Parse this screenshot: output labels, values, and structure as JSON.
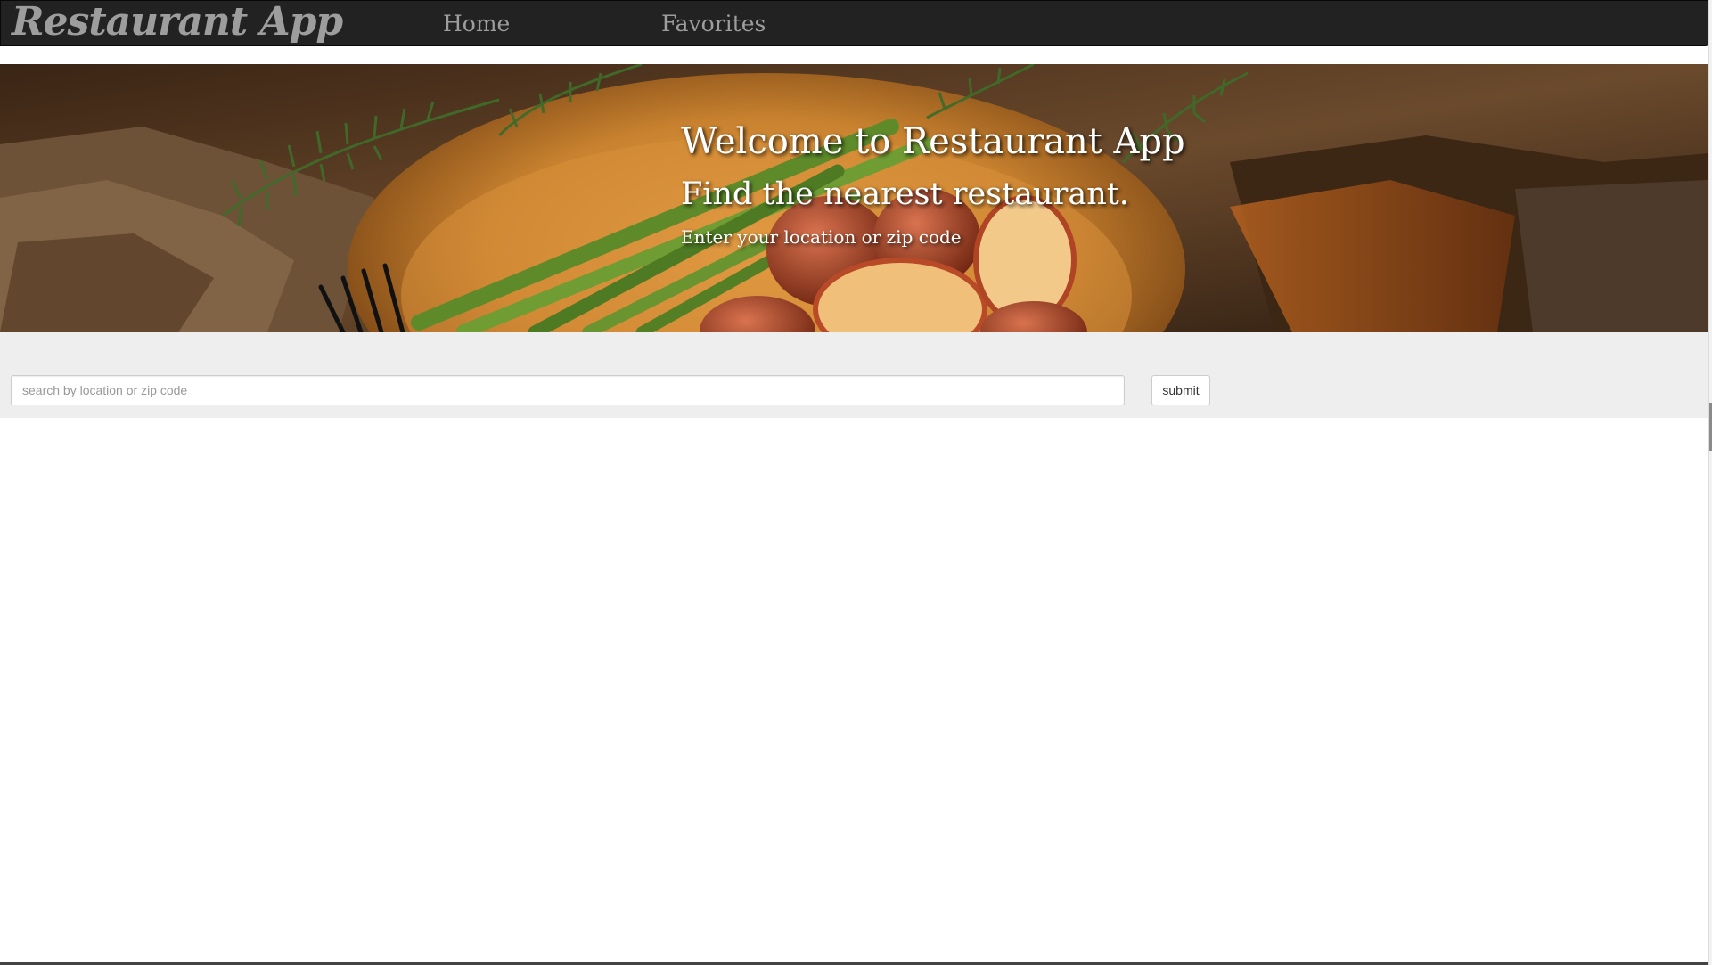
{
  "navbar": {
    "brand": "Restaurant App",
    "links": [
      {
        "label": "Home"
      },
      {
        "label": "Favorites"
      }
    ]
  },
  "hero": {
    "title": "Welcome to Restaurant App",
    "subtitle": "Find the nearest restaurant.",
    "hint": "Enter your location or zip code"
  },
  "search": {
    "placeholder": "search by location or zip code",
    "value": "",
    "submit_label": "submit"
  },
  "colors": {
    "navbar_bg": "#222222",
    "navbar_text": "#9d9d9d",
    "search_band_bg": "#eeeeee",
    "hero_text": "#ffffff"
  }
}
